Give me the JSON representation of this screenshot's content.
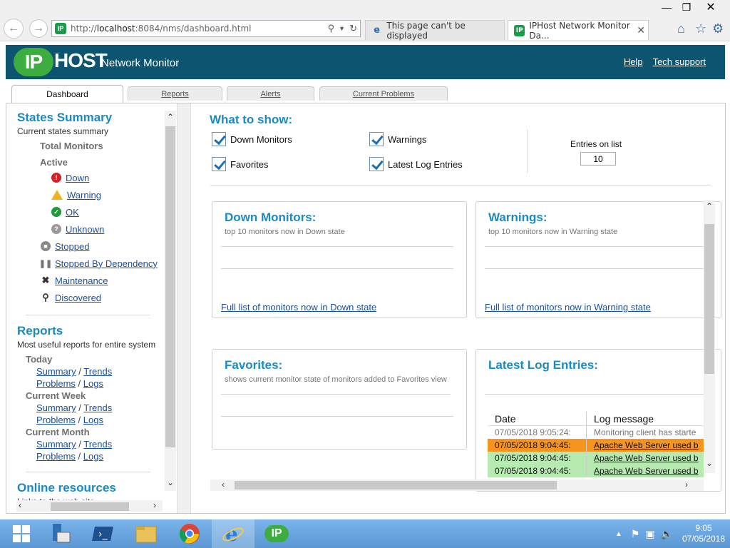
{
  "browser": {
    "url_prefix": "http://",
    "url_host": "localhost",
    "url_rest": ":8084/nms/dashboard.html",
    "tabs": [
      {
        "title": "This page can't be displayed",
        "active": false
      },
      {
        "title": "IPHost Network Monitor Da...",
        "active": true
      }
    ],
    "favicon_text": "IP"
  },
  "app": {
    "logo_ip": "IP",
    "logo_host": "HOST",
    "logo_sub": "Network Monitor",
    "header_links": [
      "Help",
      "Tech support"
    ],
    "tabs": [
      "Dashboard",
      "Reports",
      "Alerts",
      "Current Problems"
    ],
    "colors": {
      "header_bg": "#0c5470",
      "accent": "#1a8ac4",
      "logo_green": "#3dad3f"
    }
  },
  "sidebar": {
    "states_title": "States Summary",
    "states_sub": "Current states summary",
    "total_monitors": "Total Monitors",
    "active": "Active",
    "states": [
      {
        "label": "Down",
        "icon": "error-icon"
      },
      {
        "label": "Warning",
        "icon": "warning-icon"
      },
      {
        "label": "OK",
        "icon": "ok-icon"
      },
      {
        "label": "Unknown",
        "icon": "unknown-icon"
      }
    ],
    "other_states": [
      {
        "label": "Stopped",
        "icon": "stop-icon"
      },
      {
        "label": "Stopped By Dependency",
        "icon": "pause-icon"
      },
      {
        "label": "Maintenance",
        "icon": "tools-icon"
      },
      {
        "label": "Discovered",
        "icon": "search-icon"
      }
    ],
    "reports_title": "Reports",
    "reports_sub": "Most useful reports for entire system",
    "periods": [
      {
        "label": "Today"
      },
      {
        "label": "Current Week"
      },
      {
        "label": "Current Month"
      }
    ],
    "report_links": {
      "summary": "Summary",
      "trends": "Trends",
      "problems": "Problems",
      "logs": "Logs",
      "sep": "/"
    },
    "online_title": "Online resources",
    "online_sub": "Links to the web site"
  },
  "content": {
    "what_title": "What to show:",
    "checkboxes": [
      {
        "label": "Down Monitors",
        "checked": true
      },
      {
        "label": "Warnings",
        "checked": true
      },
      {
        "label": "Favorites",
        "checked": true
      },
      {
        "label": "Latest Log Entries",
        "checked": true
      }
    ],
    "entries_label": "Entries on list",
    "entries_value": "10",
    "panels": {
      "down": {
        "title": "Down Monitors:",
        "sub": "top 10 monitors now in Down state",
        "link": "Full list of monitors now in Down state"
      },
      "warnings": {
        "title": "Warnings:",
        "sub": "top 10 monitors now in Warning state",
        "link": "Full list of monitors now in Warning state"
      },
      "favorites": {
        "title": "Favorites:",
        "sub": "shows current monitor state of monitors added to Favorites view"
      },
      "log": {
        "title": "Latest Log Entries:",
        "col_date": "Date",
        "col_msg": "Log message",
        "rows": [
          {
            "date": "07/05/2018 9:05:24:",
            "msg": "Monitoring client has starte",
            "bg": "#ffffff",
            "fg": "#777777",
            "link": false
          },
          {
            "date": "07/05/2018 9:04:45:",
            "msg": "Apache Web Server used b",
            "bg": "#f7941d",
            "fg": "#111111",
            "link": true
          },
          {
            "date": "07/05/2018 9:04:45:",
            "msg": "Apache Web Server used b",
            "bg": "#b6eab0",
            "fg": "#111111",
            "link": true
          },
          {
            "date": "07/05/2018 9:04:45:",
            "msg": "Apache Web Server used b",
            "bg": "#b6eab0",
            "fg": "#111111",
            "link": true
          }
        ]
      }
    }
  },
  "taskbar": {
    "time": "9:05",
    "date": "07/05/2018",
    "apps": [
      "start",
      "server-manager",
      "powershell",
      "file-explorer",
      "chrome",
      "internet-explorer",
      "iphost"
    ]
  }
}
